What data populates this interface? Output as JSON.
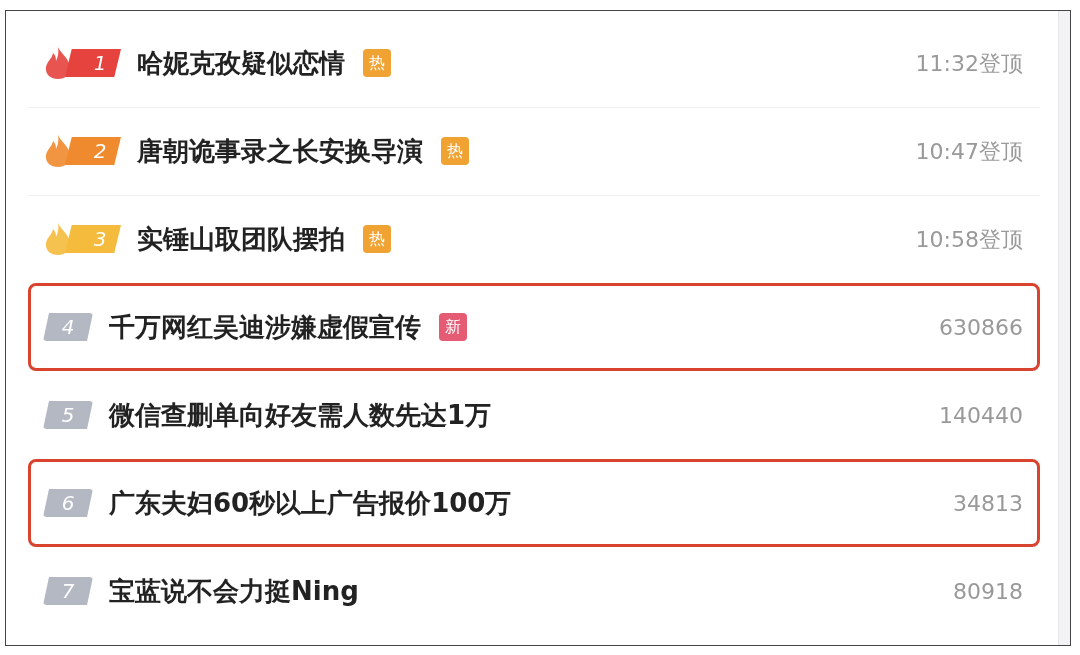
{
  "items": [
    {
      "rank": "1",
      "title": "哈妮克孜疑似恋情",
      "tag": {
        "text": "热",
        "kind": "hot"
      },
      "meta": "11:32登顶",
      "badge": {
        "kind": "flame",
        "color": "#e6433e"
      },
      "highlighted": false
    },
    {
      "rank": "2",
      "title": "唐朝诡事录之长安换导演",
      "tag": {
        "text": "热",
        "kind": "hot"
      },
      "meta": "10:47登顶",
      "badge": {
        "kind": "flame",
        "color": "#f08a2e"
      },
      "highlighted": false
    },
    {
      "rank": "3",
      "title": "实锤山取团队摆拍",
      "tag": {
        "text": "热",
        "kind": "hot"
      },
      "meta": "10:58登顶",
      "badge": {
        "kind": "flame",
        "color": "#f4bb3c"
      },
      "highlighted": false
    },
    {
      "rank": "4",
      "title": "千万网红吴迪涉嫌虚假宣传",
      "tag": {
        "text": "新",
        "kind": "new"
      },
      "meta": "630866",
      "badge": {
        "kind": "plain",
        "color": "#b4b8c3"
      },
      "highlighted": true
    },
    {
      "rank": "5",
      "title": "微信查删单向好友需人数先达1万",
      "meta": "140440",
      "badge": {
        "kind": "plain",
        "color": "#b4b8c3"
      },
      "highlighted": false
    },
    {
      "rank": "6",
      "title": "广东夫妇60秒以上广告报价100万",
      "meta": "34813",
      "badge": {
        "kind": "plain",
        "color": "#b4b8c3"
      },
      "highlighted": true
    },
    {
      "rank": "7",
      "title": "宝蓝说不会力挺Ning",
      "meta": "80918",
      "badge": {
        "kind": "plain",
        "color": "#b4b8c3"
      },
      "highlighted": false
    }
  ]
}
